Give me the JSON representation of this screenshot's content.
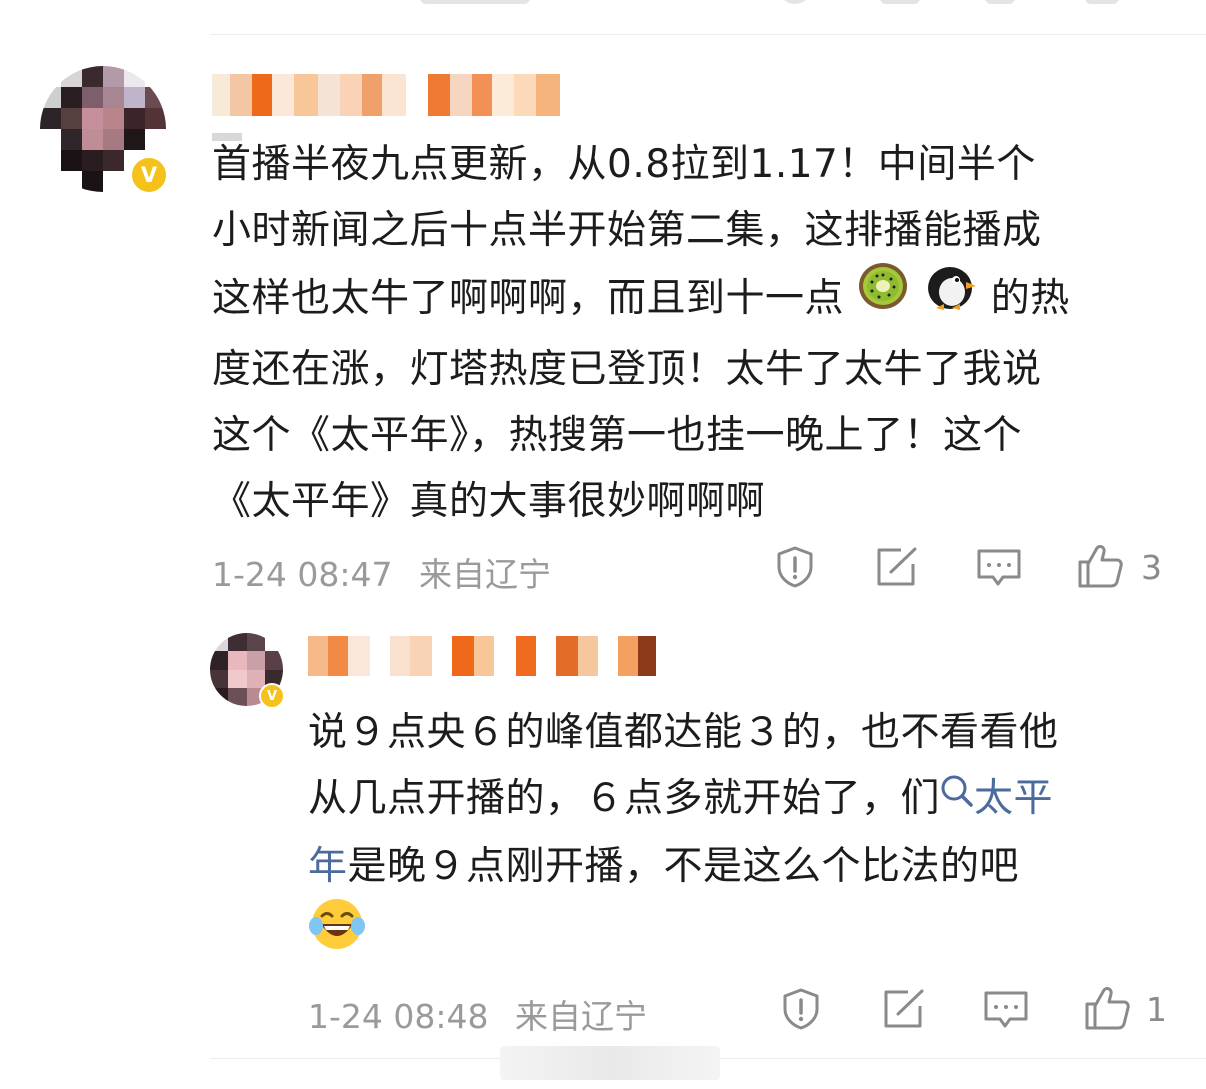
{
  "comments": [
    {
      "text_lines": [
        "首播半夜九点更新，从0.8拉到1.17！中间半个",
        "小时新闻之后十点半开始第二集，这排播能播成",
        "这样也太牛了啊啊啊，而且到十一点",
        "的热",
        "度还在涨，灯塔热度已登顶！太牛了太牛了我说",
        "这个《太平年》，热搜第一也挂一晚上了！这个",
        "《太平年》真的大事很妙啊啊啊"
      ],
      "emojis": [
        "kiwi-emoji",
        "penguin-emoji"
      ],
      "date": "1-24 08:47",
      "location": "来自辽宁",
      "like_count": "3"
    },
    {
      "text_lines": [
        "说９点央６的峰值都达能３的，也不看看他",
        "从几点开播的，６点多就开始了，们",
        "年",
        "是晚９点刚开播，不是这么个比法的吧"
      ],
      "topic_link_part1": "太平",
      "emojis": [
        "laugh-tears-emoji"
      ],
      "date": "1-24 08:48",
      "location": "来自辽宁",
      "like_count": "1"
    }
  ],
  "badge_letter": "V",
  "icons": [
    "report-icon",
    "repost-icon",
    "comment-icon",
    "like-icon",
    "search-icon"
  ],
  "colors": {
    "badge": "#f5c21b",
    "topic_link": "#4a6b9c",
    "meta_text": "#9a9a9a",
    "icon_stroke": "#8a8a8a"
  }
}
